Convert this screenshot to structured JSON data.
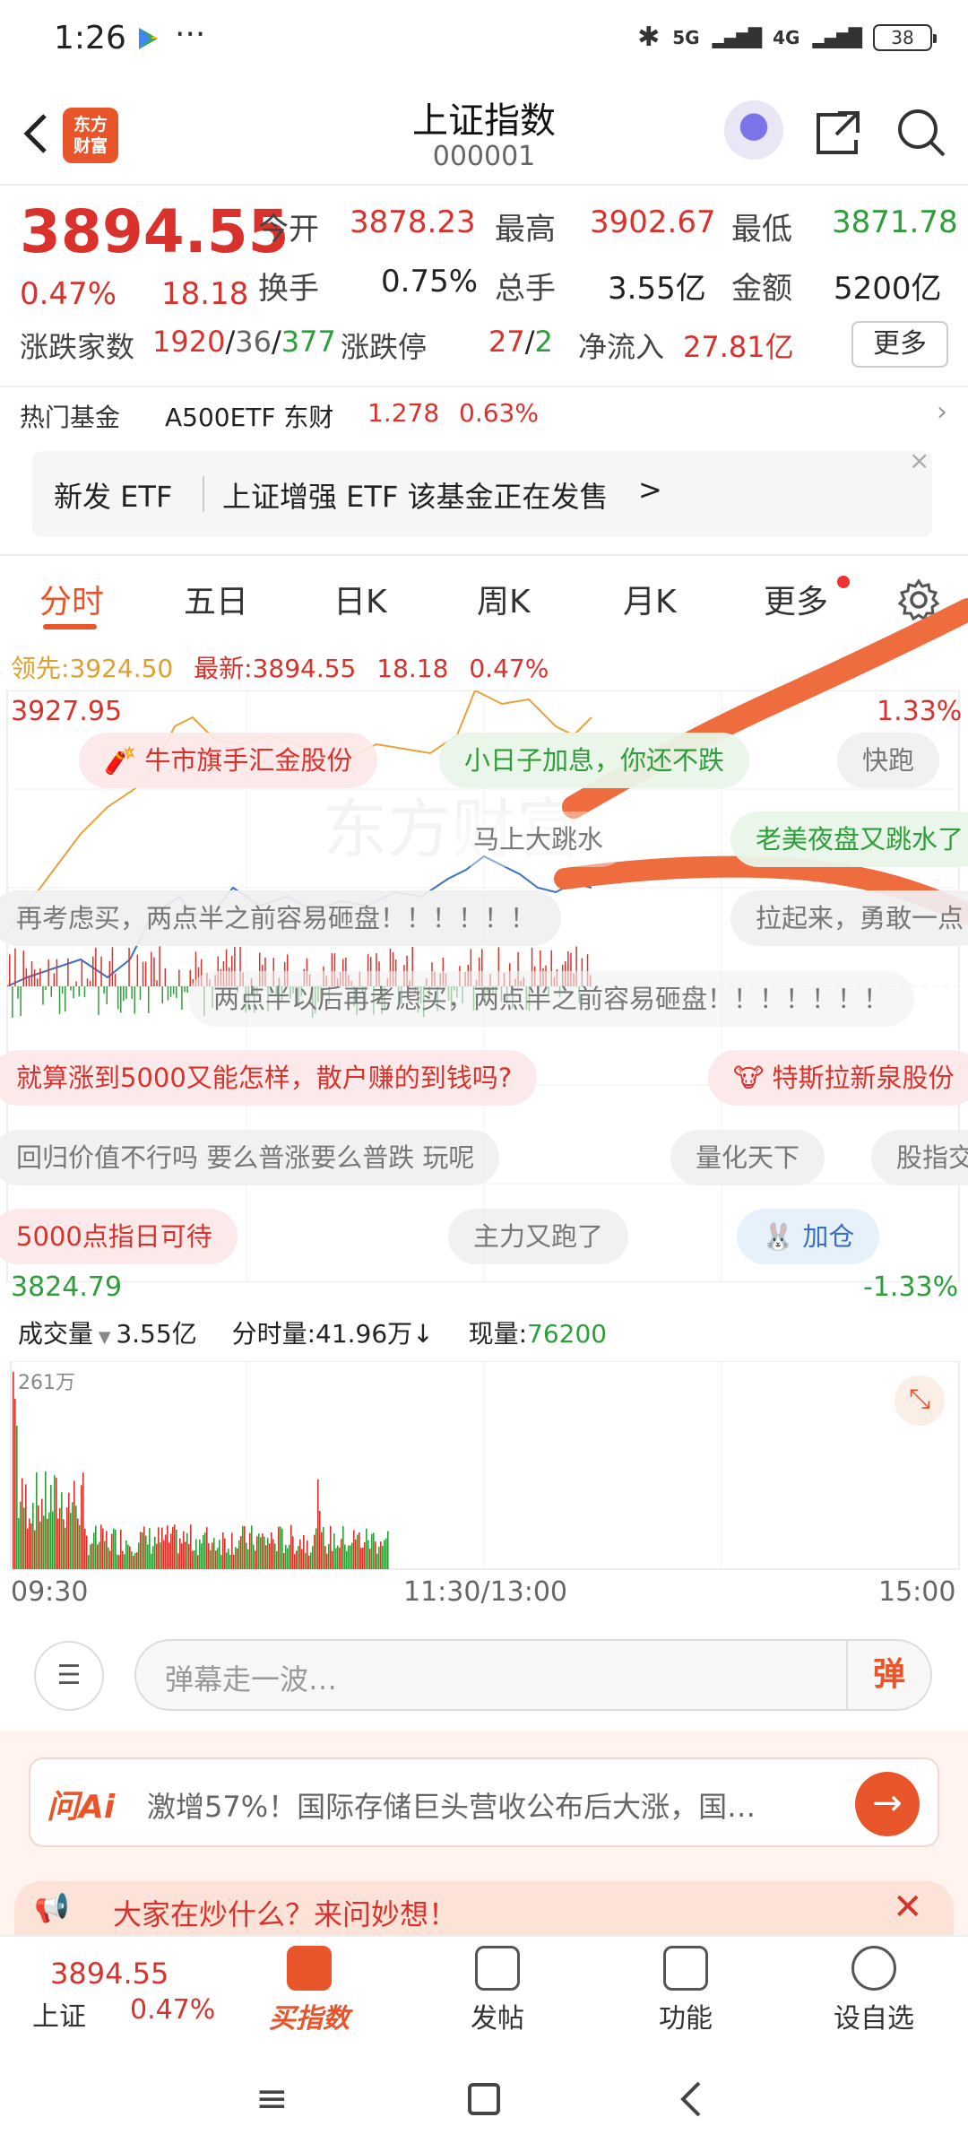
{
  "status": {
    "time": "1:26",
    "dots": "···",
    "network": "5G",
    "network2": "4G",
    "battery": "38"
  },
  "nav": {
    "logo_line1": "东方",
    "logo_line2": "财富",
    "title": "上证指数",
    "code": "000001"
  },
  "quote": {
    "price": "3894.55",
    "change_pct": "0.47%",
    "change": "18.18",
    "open_label": "今开",
    "open": "3878.23",
    "high_label": "最高",
    "high": "3902.67",
    "low_label": "最低",
    "low": "3871.78",
    "turnover_label": "换手",
    "turnover": "0.75%",
    "volume_label": "总手",
    "volume": "3.55亿",
    "amount_label": "金额",
    "amount": "5200亿",
    "updown_label": "涨跌家数",
    "up": "1920",
    "flat": "36",
    "down": "377",
    "limit_label": "涨跌停",
    "limit_up": "27",
    "limit_down": "2",
    "inflow_label": "净流入",
    "inflow": "27.81亿",
    "more": "更多"
  },
  "fund": {
    "label": "热门基金",
    "name": "A500ETF 东财",
    "price": "1.278",
    "pct": "0.63%"
  },
  "etf": {
    "tag": "新发 ETF",
    "text": "上证增强 ETF 该基金正在发售",
    "arrow": ">",
    "close": "×"
  },
  "tabs": [
    "分时",
    "五日",
    "日K",
    "周K",
    "月K",
    "更多"
  ],
  "chart": {
    "lead_label": "领先:",
    "lead_value": "3924.50",
    "latest_label": "最新:",
    "latest_value": "3894.55",
    "latest_change": "18.18",
    "latest_pct": "0.47%",
    "top_price": "3927.95",
    "top_pct": "1.33%",
    "bottom_price": "3824.79",
    "bottom_pct": "-1.33%",
    "watermark": "东方财富"
  },
  "bullets": {
    "b1": "牛市旗手汇金股份",
    "b2": "小日子加息，你还不跌",
    "b3": "快跑",
    "b4": "马上大跳水",
    "b5": "老美夜盘又跳水了",
    "b6": "再考虑买，两点半之前容易砸盘！！！！！！",
    "b7": "拉起来，勇敢一点",
    "b8": "两点半以后再考虑买，两点半之前容易砸盘！！！！！！！",
    "b9": "就算涨到5000又能怎样，散户赚的到钱吗?",
    "b10": "特斯拉新泉股份",
    "b11": "回归价值不行吗 要么普涨要么普跌 玩呢",
    "b12": "量化天下",
    "b13": "股指交",
    "b14": "5000点指日可待",
    "b15": "主力又跑了",
    "b16": "加仓"
  },
  "vol": {
    "label": "成交量",
    "total": "3.55亿",
    "min_label": "分时量:",
    "min_value": "41.96万",
    "arrow": "↓",
    "now_label": "现量:",
    "now_value": "76200",
    "max": "261万",
    "t1": "09:30",
    "t2": "11:30/13:00",
    "t3": "15:00"
  },
  "danmaku": {
    "placeholder": "弹幕走一波…",
    "btn": "弹"
  },
  "ask": {
    "brand": "问Ai",
    "text": "激增57%！国际存储巨头营收公布后大涨，国…",
    "promo": "大家在炒什么？来问妙想！"
  },
  "bottom": {
    "price": "3894.55",
    "name": "上证",
    "pct": "0.47%",
    "b1": "买指数",
    "b2": "发帖",
    "b3": "功能",
    "b4": "设自选"
  }
}
